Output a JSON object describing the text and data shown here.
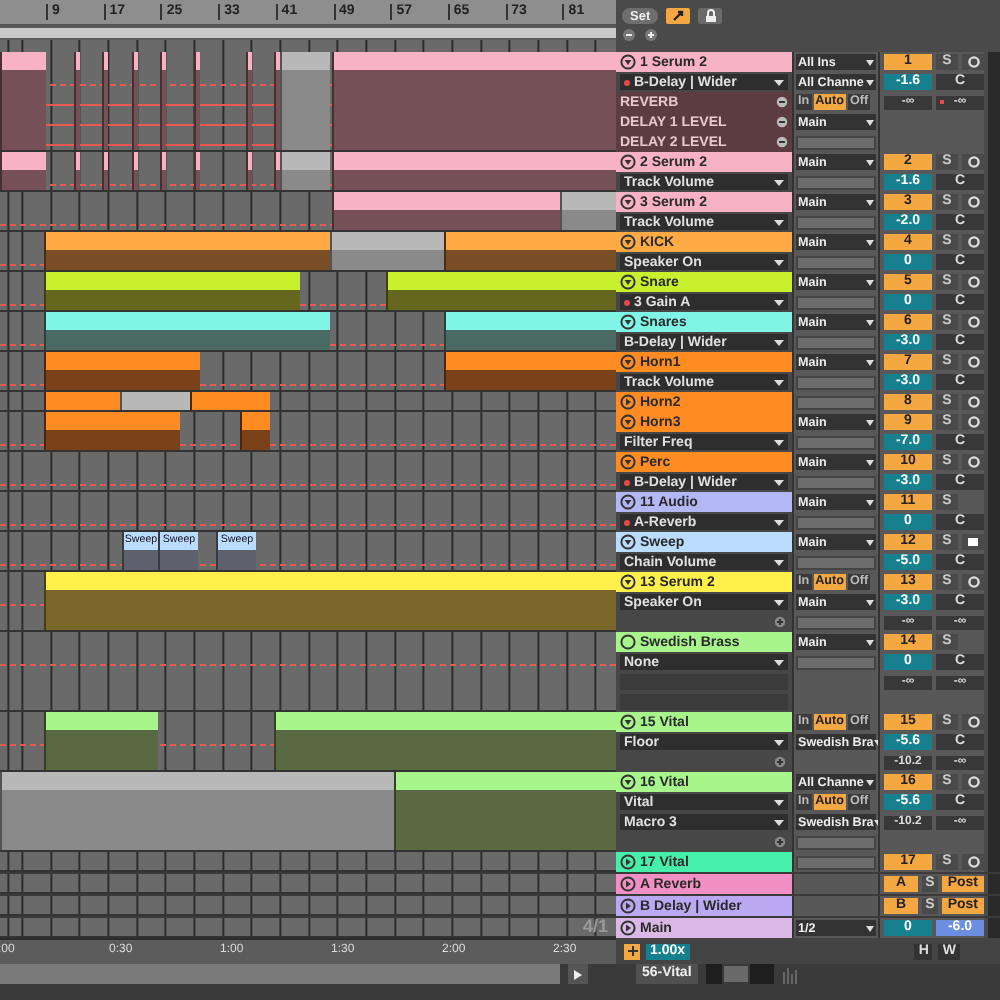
{
  "top": {
    "bar_numbers": [
      "9",
      "17",
      "25",
      "33",
      "41",
      "49",
      "57",
      "65",
      "73",
      "81"
    ],
    "set_button": "Set",
    "follow_on": true
  },
  "tracks": [
    {
      "name": "1 Serum 2",
      "color": "#f7b3c5",
      "kind": "track",
      "expanded": true,
      "params": [
        {
          "kind": "chooser",
          "label": "B-Delay | Wider",
          "automated": true
        },
        {
          "kind": "lane",
          "label": "REVERB"
        },
        {
          "kind": "lane",
          "label": "DELAY 1 LEVEL"
        },
        {
          "kind": "lane",
          "label": "DELAY 2 LEVEL"
        }
      ],
      "routing": [
        {
          "kind": "dropdown",
          "value": "All Ins"
        },
        {
          "kind": "dropdown",
          "value": "All Channe"
        },
        {
          "kind": "monitor",
          "options": [
            {
              "label": "In",
              "selected": false
            },
            {
              "label": "Auto",
              "selected": true
            },
            {
              "label": "Off",
              "selected": false
            }
          ]
        },
        {
          "kind": "dropdown",
          "value": "Main"
        },
        {
          "kind": "field"
        }
      ],
      "number": "1",
      "solo": "S",
      "armed": false,
      "volume": "-1.6",
      "pan": "C",
      "peaks": [
        {
          "value": "-∞",
          "clipped": false
        },
        {
          "value": "-∞",
          "clipped": true
        }
      ],
      "clips": [
        {
          "disabled": false
        },
        {
          "disabled": false
        },
        {
          "disabled": false
        },
        {
          "disabled": false
        },
        {
          "disabled": false
        },
        {
          "disabled": false
        },
        {
          "disabled": false
        },
        {
          "disabled": false
        },
        {
          "disabled": true
        },
        {
          "disabled": false
        }
      ]
    },
    {
      "name": "2 Serum 2",
      "color": "#f7b3c5",
      "kind": "track",
      "expanded": true,
      "params": [
        {
          "kind": "chooser",
          "label": "Track Volume",
          "automated": false
        }
      ],
      "routing": [
        {
          "kind": "dropdown",
          "value": "Main"
        },
        {
          "kind": "field"
        }
      ],
      "number": "2",
      "solo": "S",
      "armed": false,
      "volume": "-1.6",
      "pan": "C",
      "clips": [
        {
          "disabled": false
        },
        {
          "disabled": false
        },
        {
          "disabled": false
        },
        {
          "disabled": false
        },
        {
          "disabled": false
        },
        {
          "disabled": false
        },
        {
          "disabled": false
        },
        {
          "disabled": false
        },
        {
          "disabled": true
        },
        {
          "disabled": false
        }
      ]
    },
    {
      "name": "3 Serum 2",
      "color": "#f7b3c5",
      "kind": "track",
      "expanded": true,
      "params": [
        {
          "kind": "chooser",
          "label": "Track Volume",
          "automated": false
        }
      ],
      "routing": [
        {
          "kind": "dropdown",
          "value": "Main"
        },
        {
          "kind": "field"
        }
      ],
      "number": "3",
      "solo": "S",
      "armed": false,
      "volume": "-2.0",
      "pan": "C",
      "clips": [
        {
          "disabled": false
        },
        {
          "disabled": true
        }
      ]
    },
    {
      "name": "KICK",
      "color": "#ffaa44",
      "kind": "track",
      "expanded": true,
      "params": [
        {
          "kind": "chooser",
          "label": "Speaker On",
          "automated": false
        }
      ],
      "routing": [
        {
          "kind": "dropdown",
          "value": "Main"
        },
        {
          "kind": "field"
        }
      ],
      "number": "4",
      "solo": "S",
      "armed": false,
      "volume": "0",
      "pan": "C",
      "clips": [
        {
          "disabled": false
        },
        {
          "disabled": true
        },
        {
          "disabled": false
        }
      ]
    },
    {
      "name": "Snare",
      "color": "#c8f02c",
      "kind": "track",
      "expanded": true,
      "params": [
        {
          "kind": "chooser",
          "label": "3 Gain A",
          "automated": true
        }
      ],
      "routing": [
        {
          "kind": "dropdown",
          "value": "Main"
        },
        {
          "kind": "field"
        }
      ],
      "number": "5",
      "solo": "S",
      "armed": false,
      "volume": "0",
      "pan": "C",
      "clips": [
        {
          "disabled": false
        },
        {
          "disabled": false
        }
      ]
    },
    {
      "name": "Snares",
      "color": "#80f5e6",
      "kind": "track",
      "expanded": true,
      "params": [
        {
          "kind": "chooser",
          "label": "B-Delay | Wider",
          "automated": false
        }
      ],
      "routing": [
        {
          "kind": "dropdown",
          "value": "Main"
        },
        {
          "kind": "field"
        }
      ],
      "number": "6",
      "solo": "S",
      "armed": false,
      "volume": "-3.0",
      "pan": "C",
      "clips": [
        {
          "disabled": false
        },
        {
          "disabled": false
        }
      ]
    },
    {
      "name": "Horn1",
      "color": "#ff8c22",
      "kind": "track",
      "expanded": true,
      "params": [
        {
          "kind": "chooser",
          "label": "Track Volume",
          "automated": false
        }
      ],
      "routing": [
        {
          "kind": "dropdown",
          "value": "Main"
        },
        {
          "kind": "field"
        }
      ],
      "number": "7",
      "solo": "S",
      "armed": false,
      "volume": "-3.0",
      "pan": "C",
      "clips": [
        {
          "disabled": false
        },
        {
          "disabled": false
        }
      ]
    },
    {
      "name": "Horn2",
      "color": "#ff8c22",
      "kind": "track",
      "expanded": false,
      "routing": [
        {
          "kind": "field"
        }
      ],
      "number": "8",
      "solo": "S",
      "armed": false,
      "clips": [
        {
          "disabled": false
        },
        {
          "disabled": true
        },
        {
          "disabled": false
        }
      ]
    },
    {
      "name": "Horn3",
      "color": "#ff8c22",
      "kind": "track",
      "expanded": true,
      "params": [
        {
          "kind": "chooser",
          "label": "Filter Freq",
          "automated": false
        }
      ],
      "routing": [
        {
          "kind": "dropdown",
          "value": "Main"
        },
        {
          "kind": "field"
        }
      ],
      "number": "9",
      "solo": "S",
      "armed": false,
      "volume": "-7.0",
      "pan": "C",
      "clips": [
        {
          "disabled": false
        },
        {
          "disabled": false
        }
      ]
    },
    {
      "name": "Perc",
      "color": "#ff8c22",
      "kind": "track",
      "expanded": true,
      "params": [
        {
          "kind": "chooser",
          "label": "B-Delay | Wider",
          "automated": true
        }
      ],
      "routing": [
        {
          "kind": "dropdown",
          "value": "Main"
        },
        {
          "kind": "field"
        }
      ],
      "number": "10",
      "solo": "S",
      "armed": false,
      "volume": "-3.0",
      "pan": "C"
    },
    {
      "name": "11 Audio",
      "color": "#b3b8f5",
      "kind": "track",
      "expanded": true,
      "params": [
        {
          "kind": "chooser",
          "label": "A-Reverb",
          "automated": true
        }
      ],
      "routing": [
        {
          "kind": "dropdown",
          "value": "Main"
        },
        {
          "kind": "field"
        }
      ],
      "number": "11",
      "solo": "S",
      "volume": "0",
      "pan": "C"
    },
    {
      "name": "Sweep",
      "color": "#b9dcff",
      "kind": "track",
      "expanded": true,
      "params": [
        {
          "kind": "chooser",
          "label": "Chain Volume",
          "automated": false
        }
      ],
      "routing": [
        {
          "kind": "dropdown",
          "value": "Main"
        },
        {
          "kind": "field"
        }
      ],
      "number": "12",
      "solo": "S",
      "armed": true,
      "volume": "-5.0",
      "pan": "C",
      "clips": [
        {
          "disabled": false,
          "name": "Sweep"
        },
        {
          "disabled": false,
          "name": "Sweep"
        },
        {
          "disabled": false,
          "name": "Sweep"
        }
      ]
    },
    {
      "name": "13 Serum 2",
      "color": "#fff04c",
      "kind": "track",
      "expanded": true,
      "params": [
        {
          "kind": "chooser",
          "label": "Speaker On",
          "automated": false
        },
        {
          "kind": "add"
        }
      ],
      "routing": [
        {
          "kind": "monitor",
          "options": [
            {
              "label": "In",
              "selected": false
            },
            {
              "label": "Auto",
              "selected": true
            },
            {
              "label": "Off",
              "selected": false
            }
          ]
        },
        {
          "kind": "dropdown",
          "value": "Main"
        },
        {
          "kind": "field"
        }
      ],
      "number": "13",
      "solo": "S",
      "armed": false,
      "volume": "-3.0",
      "pan": "C",
      "peaks": [
        {
          "value": "-∞",
          "clipped": false
        },
        {
          "value": "-∞",
          "clipped": false
        }
      ],
      "clips": [
        {
          "disabled": false
        }
      ]
    },
    {
      "name": "Swedish Brass",
      "color": "#a8f58c",
      "kind": "group",
      "expanded": true,
      "params": [
        {
          "kind": "chooser",
          "label": "None",
          "automated": false
        },
        {
          "kind": "field"
        },
        {
          "kind": "field"
        }
      ],
      "routing": [
        {
          "kind": "dropdown",
          "value": "Main"
        },
        {
          "kind": "field"
        }
      ],
      "number": "14",
      "solo": "S",
      "volume": "0",
      "pan": "C",
      "peaks": [
        {
          "value": "-∞",
          "clipped": false
        },
        {
          "value": "-∞",
          "clipped": false
        }
      ]
    },
    {
      "name": "15 Vital",
      "color": "#a8f58c",
      "kind": "track",
      "expanded": true,
      "params": [
        {
          "kind": "chooser",
          "label": "Floor",
          "automated": false
        },
        {
          "kind": "add"
        }
      ],
      "routing": [
        {
          "kind": "monitor",
          "options": [
            {
              "label": "In",
              "selected": false
            },
            {
              "label": "Auto",
              "selected": true
            },
            {
              "label": "Off",
              "selected": false
            }
          ]
        },
        {
          "kind": "dropdown",
          "value": "Swedish Bra"
        }
      ],
      "number": "15",
      "solo": "S",
      "armed": false,
      "volume": "-5.6",
      "pan": "C",
      "peaks": [
        {
          "value": "-10.2",
          "clipped": false
        },
        {
          "value": "-∞",
          "clipped": false
        }
      ],
      "clips": [
        {
          "disabled": false
        },
        {
          "disabled": false
        }
      ]
    },
    {
      "name": "16 Vital",
      "color": "#a8f58c",
      "kind": "track",
      "expanded": true,
      "params": [
        {
          "kind": "chooser",
          "label": "Vital",
          "automated": false
        },
        {
          "kind": "chooser",
          "label": "Macro 3",
          "automated": false
        },
        {
          "kind": "add"
        }
      ],
      "routing": [
        {
          "kind": "dropdown",
          "value": "All Channe"
        },
        {
          "kind": "monitor",
          "options": [
            {
              "label": "In",
              "selected": false
            },
            {
              "label": "Auto",
              "selected": true
            },
            {
              "label": "Off",
              "selected": false
            }
          ]
        },
        {
          "kind": "dropdown",
          "value": "Swedish Bra"
        },
        {
          "kind": "field"
        }
      ],
      "number": "16",
      "solo": "S",
      "armed": false,
      "volume": "-5.6",
      "pan": "C",
      "peaks": [
        {
          "value": "-10.2",
          "clipped": false
        },
        {
          "value": "-∞",
          "clipped": false
        }
      ],
      "clips": [
        {
          "disabled": true
        },
        {
          "disabled": false
        }
      ]
    },
    {
      "name": "17 Vital",
      "color": "#46f0aa",
      "kind": "track",
      "expanded": false,
      "routing": [
        {
          "kind": "field"
        }
      ],
      "number": "17",
      "solo": "S",
      "armed": false
    },
    {
      "name": "A Reverb",
      "color": "#f290c4",
      "kind": "return",
      "expanded": false,
      "number": "A",
      "solo": "S",
      "post": {
        "label": "Post",
        "on": true
      }
    },
    {
      "name": "B Delay | Wider",
      "color": "#bba8f2",
      "kind": "return",
      "expanded": false,
      "number": "B",
      "solo": "S",
      "post": {
        "label": "Post",
        "on": true
      }
    },
    {
      "name": "Main",
      "color": "#dab8e6",
      "kind": "main",
      "expanded": false,
      "routing": [
        {
          "kind": "dropdown",
          "value": "1/2"
        }
      ],
      "volume": "0",
      "pan": "-6.0"
    }
  ],
  "bottom": {
    "zoom_label": "4/1",
    "time_labels": [
      ":00",
      "0:30",
      "1:00",
      "1:30",
      "2:00",
      "2:30"
    ],
    "speed": "1.00x",
    "h_button": "H",
    "w_button": "W",
    "device": "56-Vital"
  }
}
